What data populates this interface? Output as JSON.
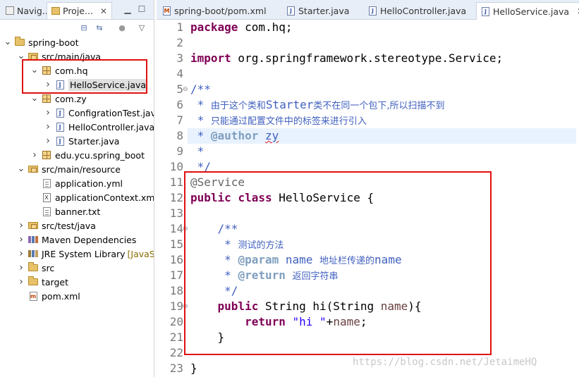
{
  "left_tabs": {
    "navigator": "Navig...",
    "project": "Proje..."
  },
  "tree": [
    {
      "label": "spring-boot",
      "icon": "project-folder-icon",
      "depth": 0,
      "expanded": true
    },
    {
      "label": "src/main/java",
      "icon": "source-folder-icon",
      "depth": 1,
      "expanded": true
    },
    {
      "label": "com.hq",
      "icon": "package-icon",
      "depth": 2,
      "expanded": true
    },
    {
      "label": "HelloService.java",
      "icon": "java-file-icon",
      "depth": 3,
      "selected": true
    },
    {
      "label": "com.zy",
      "icon": "package-icon",
      "depth": 2,
      "expanded": true
    },
    {
      "label": "ConfigrationTest.java",
      "icon": "java-file-icon",
      "depth": 3
    },
    {
      "label": "HelloController.java",
      "icon": "java-file-icon",
      "depth": 3
    },
    {
      "label": "Starter.java",
      "icon": "java-file-icon",
      "depth": 3
    },
    {
      "label": "edu.ycu.spring_boot",
      "icon": "package-icon",
      "depth": 2
    },
    {
      "label": "src/main/resource",
      "icon": "source-folder-icon",
      "depth": 1,
      "expanded": true
    },
    {
      "label": "application.yml",
      "icon": "file-icon",
      "depth": 2
    },
    {
      "label": "applicationContext.xml",
      "icon": "xml-file-icon",
      "depth": 2
    },
    {
      "label": "banner.txt",
      "icon": "file-icon",
      "depth": 2
    },
    {
      "label": "src/test/java",
      "icon": "source-folder-icon",
      "depth": 1
    },
    {
      "label": "Maven Dependencies",
      "icon": "maven-library-icon",
      "depth": 1
    },
    {
      "label": "JRE System Library",
      "deco": "[JavaSE",
      "icon": "library-icon",
      "depth": 1
    },
    {
      "label": "src",
      "icon": "folder-icon",
      "depth": 1
    },
    {
      "label": "target",
      "icon": "folder-icon",
      "depth": 1
    },
    {
      "label": "pom.xml",
      "icon": "pom-file-icon",
      "depth": 1
    }
  ],
  "editor_tabs": [
    {
      "label": "spring-boot/pom.xml",
      "icon": "maven-file-icon"
    },
    {
      "label": "Starter.java",
      "icon": "java-file-icon"
    },
    {
      "label": "HelloController.java",
      "icon": "java-file-icon"
    },
    {
      "label": "HelloService.java",
      "icon": "java-file-icon",
      "active": true
    }
  ],
  "line_numbers": [
    "1",
    "2",
    "3",
    "4",
    "5",
    "6",
    "7",
    "8",
    "9",
    "10",
    "11",
    "12",
    "13",
    "14",
    "15",
    "16",
    "17",
    "18",
    "19",
    "20",
    "21",
    "22",
    "23"
  ],
  "code": {
    "l1_kw": "package",
    "l1_rest": " com.hq;",
    "l3_kw": "import",
    "l3_rest": " org.springframework.stereotype.Service;",
    "l5": "/**",
    "l6_star": " * ",
    "l6_text": "由于这个类和",
    "l6_mono": "Starter",
    "l6_text2": "类不在同一个包下,所以扫描不到",
    "l7_star": " * ",
    "l7_text": "只能通过配置文件中的标签来进行引入",
    "l8_star": " * ",
    "l8_tag": "@author",
    "l8_sp": " ",
    "l8_name": "zy",
    "l9": " *",
    "l10": " */",
    "l11": "@Service",
    "l12_kw1": "public",
    "l12_sp1": " ",
    "l12_kw2": "class",
    "l12_rest": " HelloService {",
    "l14": "    /**",
    "l15_star": "     * ",
    "l15_text": "测试的方法",
    "l16_star": "     * ",
    "l16_tag": "@param",
    "l16_mid": " name ",
    "l16_text": "地址栏传递的",
    "l16_end": "name",
    "l17_star": "     * ",
    "l17_tag": "@return",
    "l17_sp": " ",
    "l17_text": "返回字符串",
    "l18": "     */",
    "l19_indent": "    ",
    "l19_kw": "public",
    "l19_mid": " String hi(String ",
    "l19_var": "name",
    "l19_end": "){",
    "l20_indent": "        ",
    "l20_kw": "return",
    "l20_sp": " ",
    "l20_str": "\"hi \"",
    "l20_op": "+",
    "l20_var": "name",
    "l20_end": ";",
    "l21": "    }",
    "l23": "}"
  },
  "watermark": "https://blog.csdn.net/JetaimeHQ",
  "colors": {
    "keyword": "#7f0055",
    "comment": "#3f5fbf",
    "javadoc_tag": "#7f9fbf",
    "annotation": "#646464",
    "string": "#2a00ff",
    "highlight_box": "#e01010",
    "current_line": "#e8f2fe"
  }
}
